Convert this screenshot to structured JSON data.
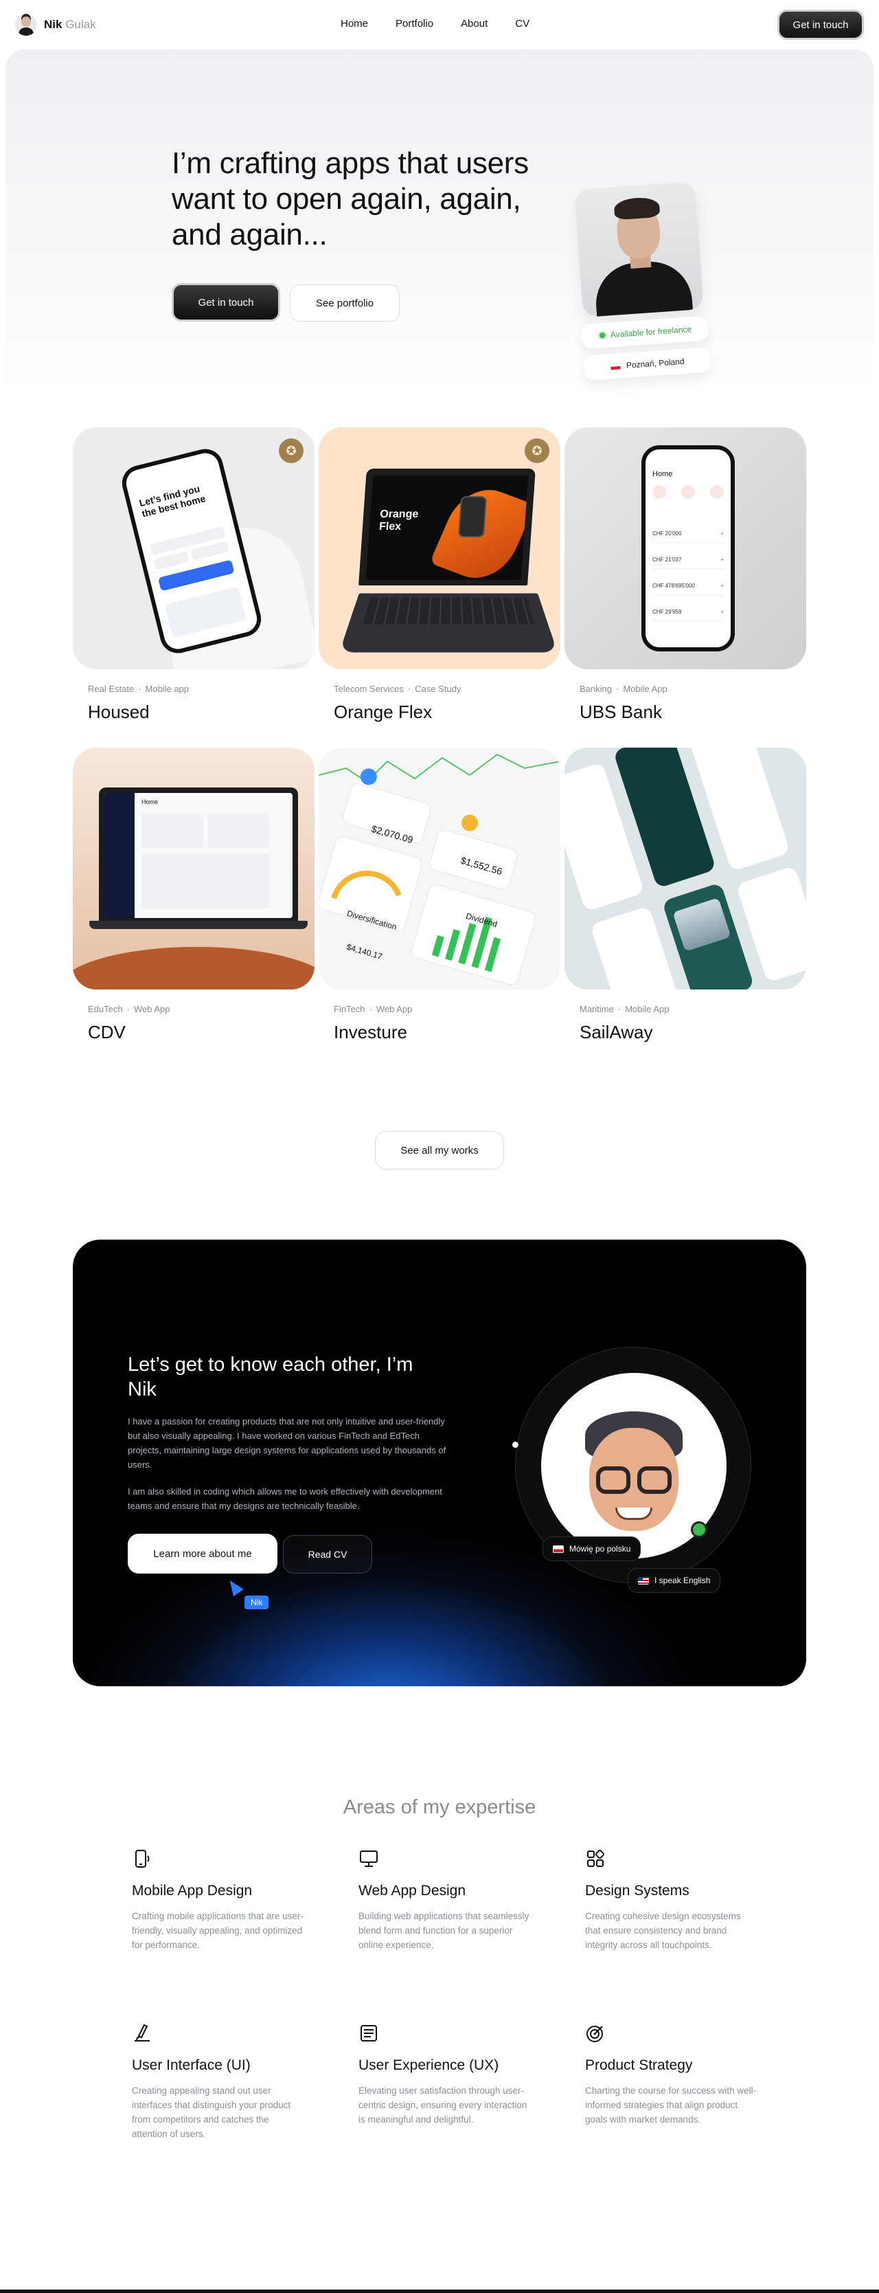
{
  "nav": {
    "first_name": "Nik",
    "last_name": "Gulak",
    "items": [
      "Home",
      "Portfolio",
      "About",
      "CV"
    ],
    "cta": "Get in touch"
  },
  "hero": {
    "title": "I’m crafting apps that users want to open again, again, and again...",
    "primary_button": "Get in touch",
    "secondary_button": "See portfolio",
    "availability": "Available for freelance",
    "location": "Poznań, Poland"
  },
  "projects": [
    {
      "category": "Real Estate",
      "type": "Mobile app",
      "title": "Housed"
    },
    {
      "category": "Telecom Services",
      "type": "Case Study",
      "title": "Orange Flex"
    },
    {
      "category": "Banking",
      "type": "Mobile App",
      "title": "UBS Bank"
    },
    {
      "category": "EduTech",
      "type": "Web App",
      "title": "CDV"
    },
    {
      "category": "FinTech",
      "type": "Web App",
      "title": "Investure"
    },
    {
      "category": "Maritime",
      "type": "Mobile App",
      "title": "SailAway"
    }
  ],
  "mockups": {
    "housed_heading": "Let’s find you the best home",
    "orange_heading": "Orange Flex",
    "ubs_header": "Home",
    "ubs_amounts": [
      "CHF 20'000",
      "CHF 21'037",
      "CHF 478'695'000",
      "CHF 29'959"
    ],
    "cdv_header": "Home",
    "investure_values": [
      "$2,070.09",
      "$1,552.56",
      "$4,140.17"
    ],
    "investure_labels": [
      "Diversification",
      "Dividend"
    ]
  },
  "see_all": "See all my works",
  "about": {
    "title": "Let’s get to know each other, I’m Nik",
    "para1": "I have a passion for creating products that are not only intuitive and user-friendly but also visually appealing. I have worked on various FinTech and EdTech projects, maintaining large design systems for applications used by thousands of users.",
    "para2": "I am also skilled in coding which allows me to work effectively with development teams and ensure that my designs are technically feasible.",
    "primary_button": "Learn more about me",
    "secondary_button": "Read CV",
    "cursor_label": "Nik",
    "lang_pl": "Mówię po polsku",
    "lang_en": "I speak English"
  },
  "expertise": {
    "title": "Areas of my expertise",
    "items": [
      {
        "icon": "mobile-icon",
        "title": "Mobile App Design",
        "desc": "Crafting mobile applications that are user-friendly, visually appealing, and optimized for performance."
      },
      {
        "icon": "monitor-icon",
        "title": "Web App Design",
        "desc": "Building web applications that seamlessly blend form and function for a superior online experience."
      },
      {
        "icon": "grid-icon",
        "title": "Design Systems",
        "desc": "Creating cohesive design ecosystems that ensure consistency and brand integrity across all touchpoints."
      },
      {
        "icon": "pen-icon",
        "title": "User Interface (UI)",
        "desc": "Creating appealing stand out user interfaces that distinguish your product from competitors and catches the attention of users."
      },
      {
        "icon": "document-icon",
        "title": "User Experience (UX)",
        "desc": "Elevating user satisfaction through user-centric design, ensuring every interaction is meaningful and delightful."
      },
      {
        "icon": "target-icon",
        "title": "Product Strategy",
        "desc": "Charting the course for success with well-informed strategies that align product goals with market demands."
      }
    ]
  },
  "colors": {
    "dark_button": "#111111",
    "accent_green": "#3dbb4f",
    "accent_blue": "#2f7dff",
    "award_gold": "#a1804f"
  }
}
